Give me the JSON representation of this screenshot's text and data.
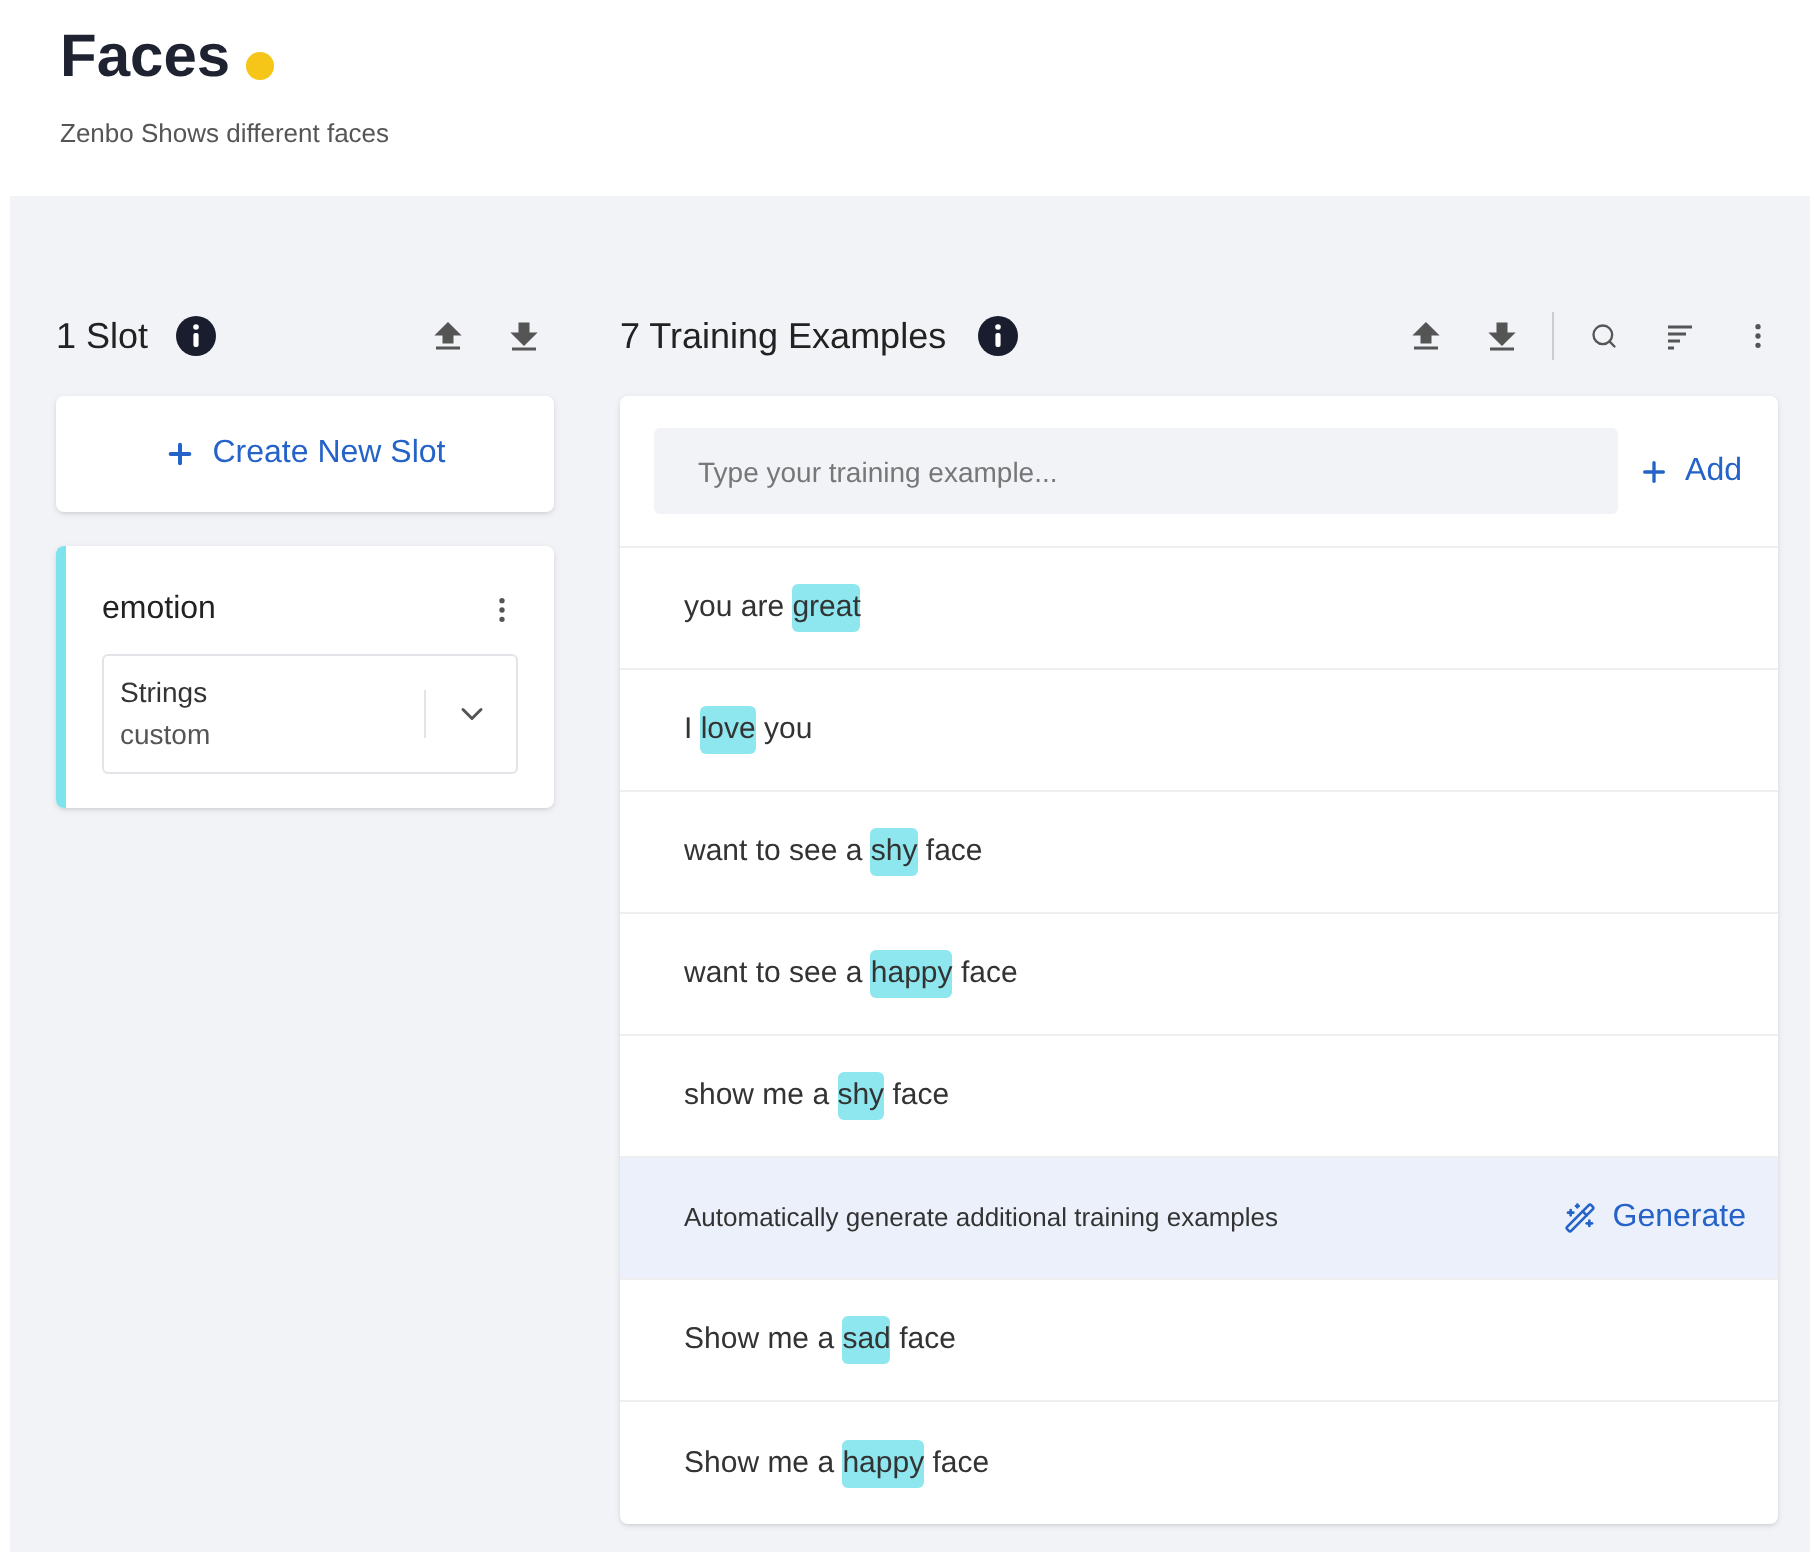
{
  "header": {
    "title": "Faces",
    "subtitle": "Zenbo Shows different faces"
  },
  "slots_panel": {
    "title": "1 Slot",
    "create_button": "Create New Slot",
    "slots": [
      {
        "name": "emotion",
        "type": "Strings",
        "subtype": "custom",
        "color": "#7fe3ee"
      }
    ]
  },
  "examples_panel": {
    "title": "7 Training Examples",
    "input": {
      "placeholder": "Type your training example..."
    },
    "add_button": "Add",
    "rows": [
      {
        "kind": "example",
        "before": "you are ",
        "value": "great",
        "after": ""
      },
      {
        "kind": "example",
        "before": "I ",
        "value": "love",
        "after": " you"
      },
      {
        "kind": "example",
        "before": "want to see a ",
        "value": "shy",
        "after": " face"
      },
      {
        "kind": "example",
        "before": "want to see a ",
        "value": "happy",
        "after": " face"
      },
      {
        "kind": "example",
        "before": "show me a ",
        "value": "shy",
        "after": " face"
      },
      {
        "kind": "generate",
        "text": "Automatically generate additional training examples",
        "button": "Generate"
      },
      {
        "kind": "example",
        "before": "Show me a ",
        "value": "sad",
        "after": " face"
      },
      {
        "kind": "example",
        "before": "Show me a ",
        "value": "happy",
        "after": " face"
      }
    ]
  }
}
